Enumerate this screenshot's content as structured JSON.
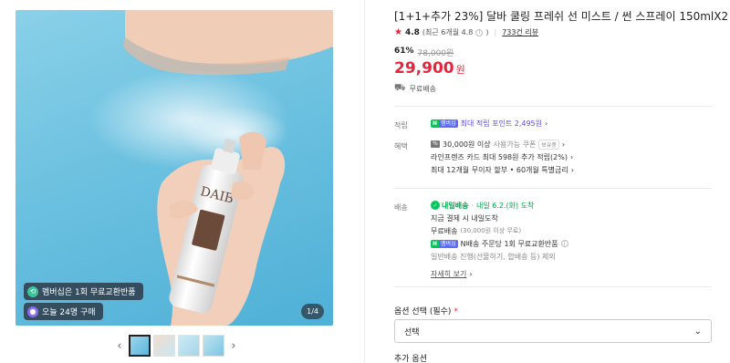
{
  "gallery": {
    "badge_membership": "멤버십은 1회 무료교환반품",
    "badge_orders": "오늘 24명 구매",
    "pager": "1/4",
    "prev_arrow": "‹",
    "next_arrow": "›",
    "product_label": "DAIB"
  },
  "product": {
    "title": "[1+1+추가 23%] 달바 쿨링 프레쉬 선 미스트 / 썬 스프레이 150mlX2",
    "rating_star": "★",
    "rating": "4.8",
    "rating_recent": "(최근 6개월 4.8",
    "rating_recent_close": ")",
    "reviews": "733건 리뷰",
    "discount_rate": "61%",
    "original_price": "78,000원",
    "price": "29,900",
    "price_unit": "원",
    "shipping": "무료배송"
  },
  "points": {
    "label": "적립",
    "text": "최대 적립 포인트 2,495원",
    "chevron": "›"
  },
  "benefits": {
    "label": "혜택",
    "coupon_amount": "30,000원 이상",
    "coupon_text": "사용가능 쿠폰",
    "coupon_pill": "보유중",
    "card": "라인프렌즈 카드 최대 598원 추가 적립(2%)",
    "installment": "최대 12개월 무이자 할부 • 60개월 특별금리",
    "chevron": "›"
  },
  "delivery": {
    "label": "배송",
    "tomorrow_tag": "내일배송",
    "arrival": "내일 6.2.(화) 도착",
    "note": "지금 결제 시 내일도착",
    "free": "무료배송",
    "free_condition": "(30,000원 이상 무료)",
    "npay_return": "N배송 주문당 1회 무료교환반품",
    "general": "일반배송 진행(선물하기, 합배송 등) 제외",
    "more": "자세히 보기",
    "chevron": "›"
  },
  "npay_badge": {
    "n": "N",
    "membership": "멤버십"
  },
  "options": {
    "label": "옵션 선택 (필수)",
    "required_mark": "*",
    "select_value": "선택",
    "additional_label": "추가 옵션"
  },
  "colors": {
    "accent_red": "#e8243c",
    "npay_green": "#03c75a",
    "purple": "#5c4ee5"
  }
}
